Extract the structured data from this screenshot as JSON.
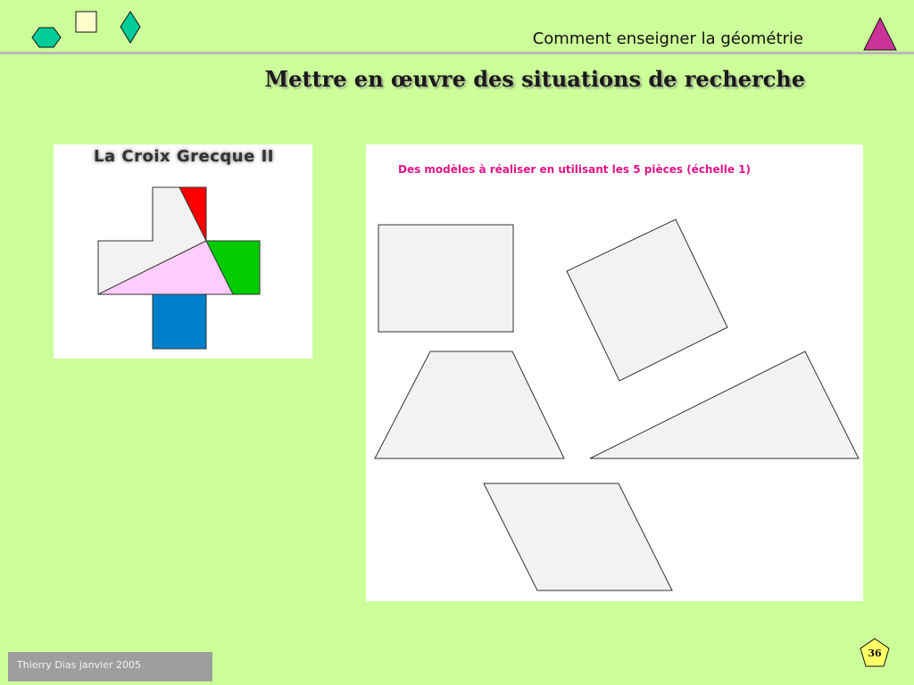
{
  "header": {
    "subtitle": "Comment enseigner la géométrie",
    "title": "Mettre en œuvre des situations de recherche"
  },
  "left_figure": {
    "title": "La Croix Grecque II",
    "piece_colors": [
      "#f2f2f2",
      "#ff0000",
      "#00cc00",
      "#ffccff",
      "#0080cc"
    ]
  },
  "right_figure": {
    "caption": "Des modèles à réaliser en utilisant les 5 pièces (échelle 1)",
    "shapes": [
      "square",
      "tilted-square",
      "trapezoid",
      "triangle",
      "parallelogram"
    ],
    "fill_color": "#f2f2f2"
  },
  "decorations": {
    "icons": [
      "hexagon-icon",
      "square-icon",
      "diamond-icon",
      "triangle-icon",
      "pentagon-icon"
    ],
    "colors": {
      "hexagon": "#00cc99",
      "square": "#ffffcc",
      "diamond": "#00cc99",
      "triangle": "#cc3399",
      "pentagon": "#ffff66"
    }
  },
  "footer": {
    "author": "Thierry Dias janvier 2005",
    "page_number": "36"
  }
}
